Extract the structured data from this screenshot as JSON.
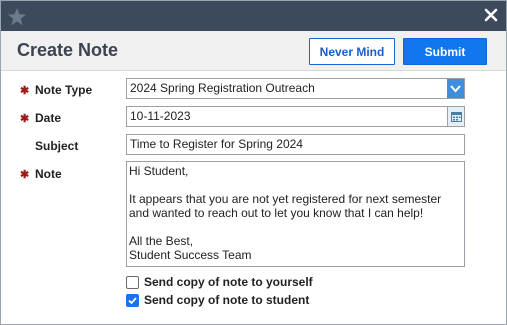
{
  "dialog": {
    "title": "Create Note",
    "buttons": {
      "never_mind": "Never Mind",
      "submit": "Submit"
    }
  },
  "fields": {
    "note_type": {
      "label": "Note Type",
      "value": "2024 Spring Registration Outreach",
      "required": true
    },
    "date": {
      "label": "Date",
      "value": "10-11-2023",
      "required": true
    },
    "subject": {
      "label": "Subject",
      "value": "Time to Register for Spring 2024",
      "required": false
    },
    "note": {
      "label": "Note",
      "value": "Hi Student,\n\nIt appears that you are not yet registered for next semester and wanted to reach out to let you know that I can help!\n\nAll the Best,\nStudent Success Team",
      "required": true
    }
  },
  "required_marker": "✱",
  "checkboxes": [
    {
      "label": "Send copy of note to yourself",
      "checked": false
    },
    {
      "label": "Send copy of note to student",
      "checked": true
    }
  ],
  "icons": {
    "titlebar_logo": "star-logo-icon",
    "close": "close-icon",
    "dropdown": "chevron-down-icon",
    "calendar": "calendar-icon"
  },
  "colors": {
    "titlebar": "#3c4a5c",
    "accent": "#1177ee",
    "required": "#a01818"
  }
}
